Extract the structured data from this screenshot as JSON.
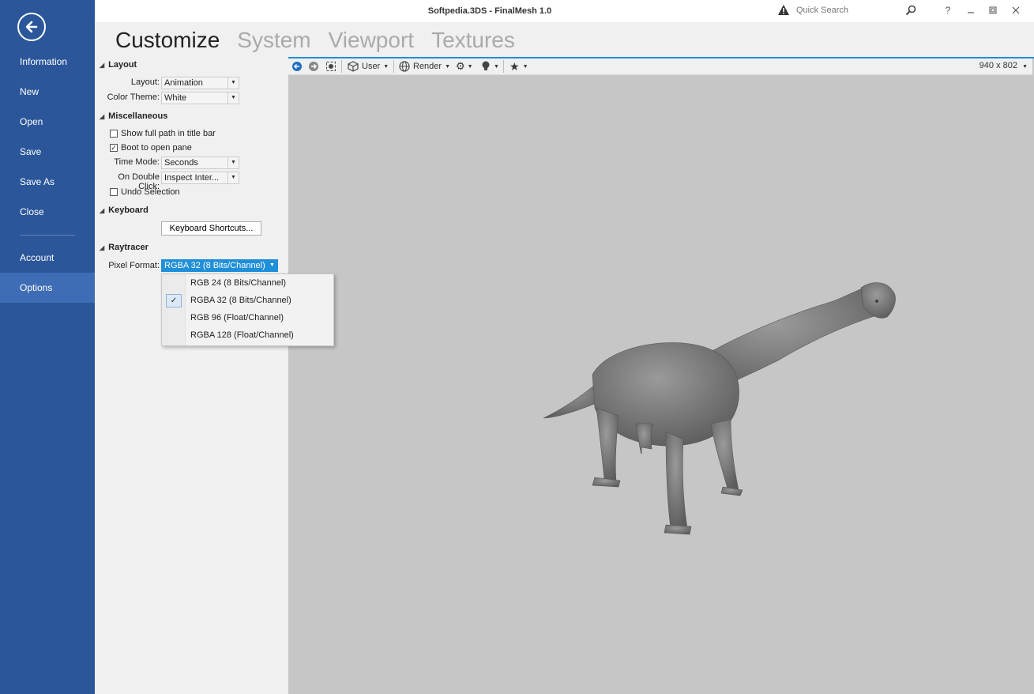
{
  "window": {
    "title": "Softpedia.3DS - FinalMesh 1.0",
    "search_placeholder": "Quick Search"
  },
  "sidebar": {
    "items": [
      {
        "label": "Information"
      },
      {
        "label": "New"
      },
      {
        "label": "Open"
      },
      {
        "label": "Save"
      },
      {
        "label": "Save As"
      },
      {
        "label": "Close"
      },
      {
        "label": "Account"
      },
      {
        "label": "Options",
        "active": true
      }
    ]
  },
  "tabs": [
    {
      "label": "Customize",
      "active": true
    },
    {
      "label": "System"
    },
    {
      "label": "Viewport"
    },
    {
      "label": "Textures"
    }
  ],
  "options": {
    "layout": {
      "heading": "Layout",
      "layout_label": "Layout:",
      "layout_value": "Animation",
      "theme_label": "Color Theme:",
      "theme_value": "White"
    },
    "misc": {
      "heading": "Miscellaneous",
      "show_full_path": {
        "label": "Show full path in title bar",
        "checked": false
      },
      "boot_open_pane": {
        "label": "Boot to open pane",
        "checked": true
      },
      "time_mode_label": "Time Mode:",
      "time_mode_value": "Seconds",
      "double_click_label": "On Double Click:",
      "double_click_value": "Inspect Inter...",
      "undo_selection": {
        "label": "Undo Selection",
        "checked": false
      }
    },
    "keyboard": {
      "heading": "Keyboard",
      "shortcuts_button": "Keyboard Shortcuts..."
    },
    "raytracer": {
      "heading": "Raytracer",
      "pixel_format_label": "Pixel Format:",
      "pixel_format_value": "RGBA 32 (8 Bits/Channel)",
      "dropdown_options": [
        {
          "label": "RGB 24 (8 Bits/Channel)",
          "selected": false
        },
        {
          "label": "RGBA 32 (8 Bits/Channel)",
          "selected": true
        },
        {
          "label": "RGB 96 (Float/Channel)",
          "selected": false
        },
        {
          "label": "RGBA 128 (Float/Channel)",
          "selected": false
        }
      ]
    }
  },
  "viewport": {
    "camera_label": "User",
    "render_label": "Render",
    "resolution": "940 x 802"
  },
  "colors": {
    "sidebar_bg": "#2b579a",
    "sidebar_active": "#3e6db5",
    "accent": "#1e8fd8",
    "viewport_bg": "#c6c6c6"
  }
}
